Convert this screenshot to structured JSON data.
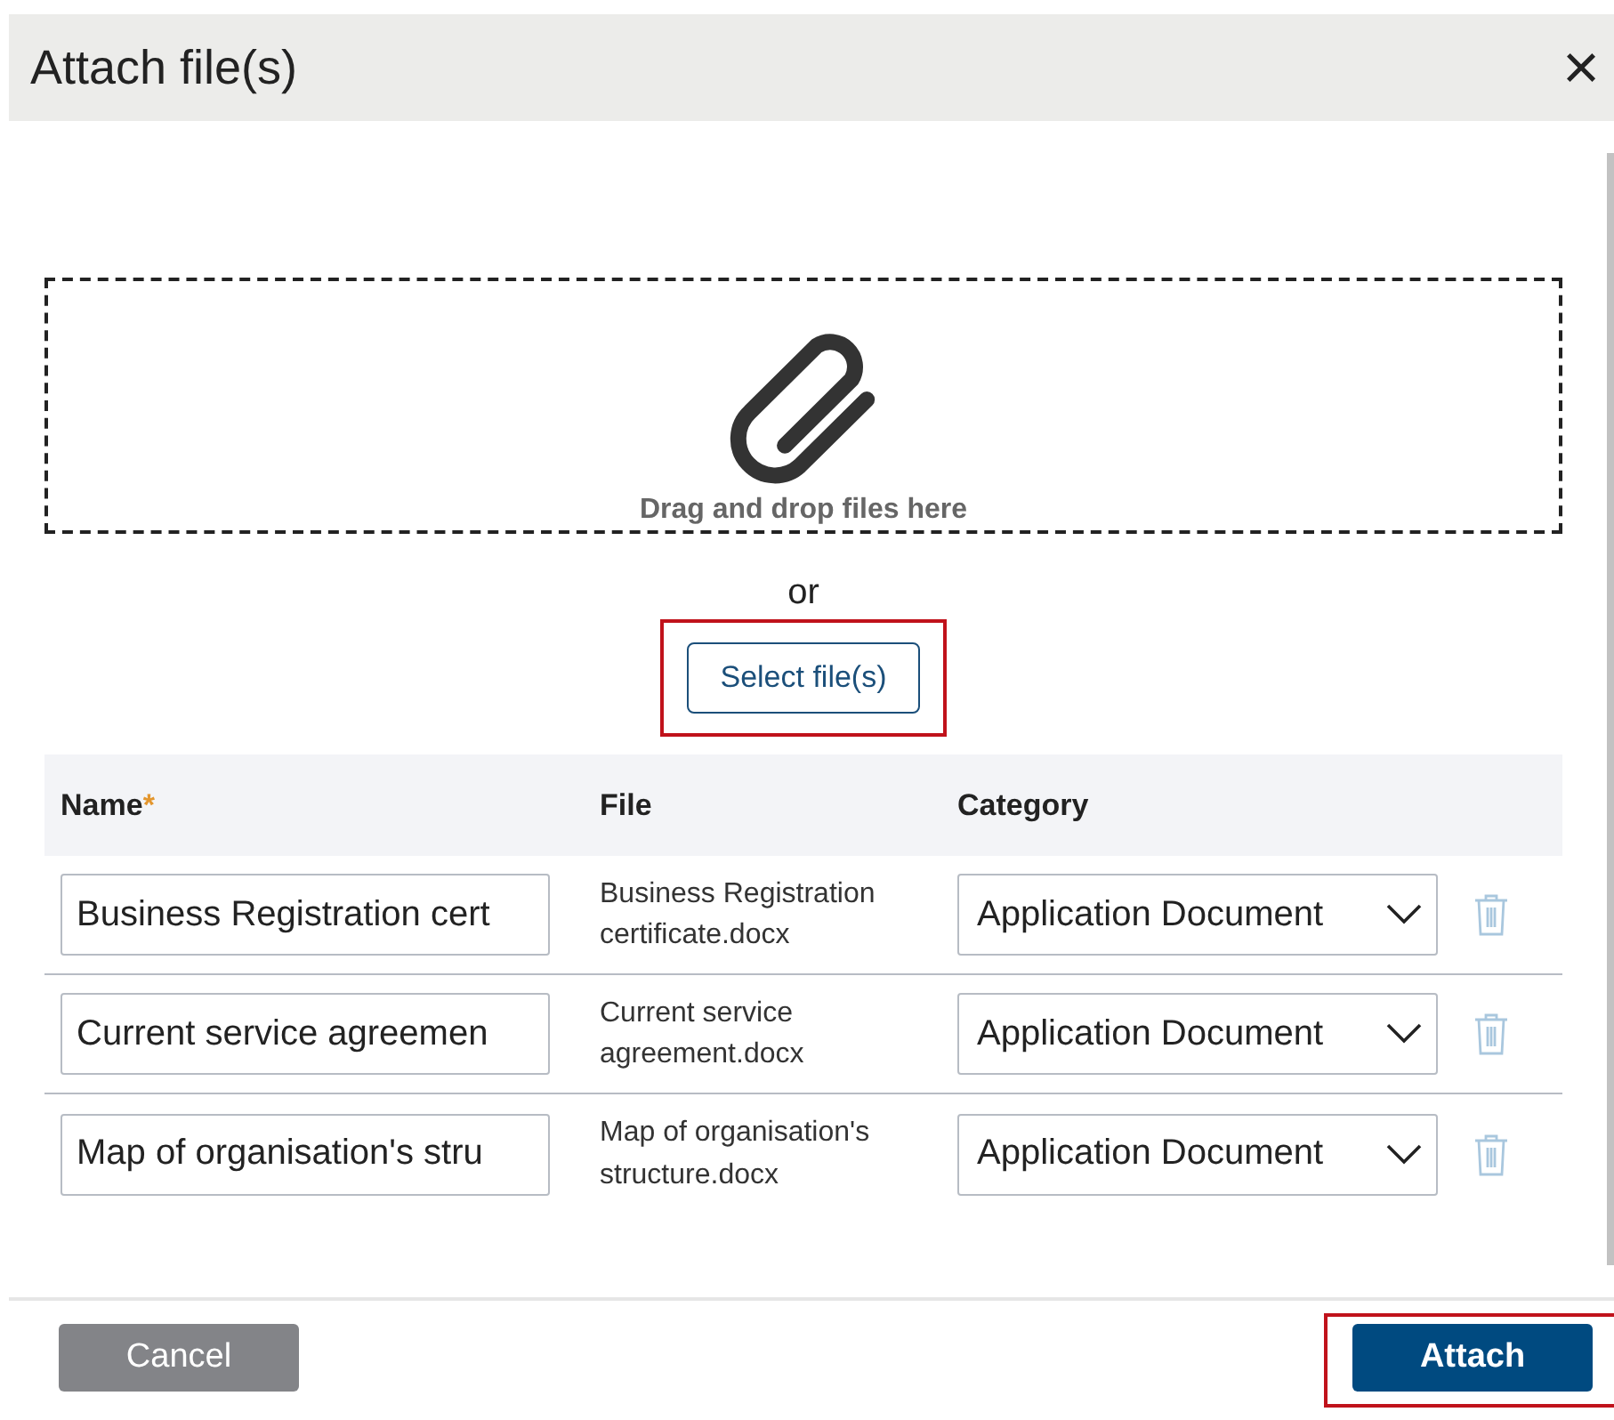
{
  "dialog": {
    "title": "Attach file(s)",
    "close": "×"
  },
  "dropzone": {
    "label": "Drag and drop files here"
  },
  "separator": "or",
  "select_button": {
    "label": "Select file(s)",
    "highlighted": true
  },
  "table": {
    "required_mark": "*",
    "columns": [
      {
        "label": "Name",
        "required": true
      },
      {
        "label": "File",
        "required": false
      },
      {
        "label": "Category",
        "required": false
      }
    ],
    "rows": [
      {
        "name": "Business Registration cert",
        "file": "Business Registration certificate.docx",
        "category": "Application Document"
      },
      {
        "name": "Current service agreemen",
        "file": "Current service agreement.docx",
        "category": "Application Document"
      },
      {
        "name": "Map of organisation's stru",
        "file": "Map of organisation's structure.docx",
        "category": "Application Document"
      }
    ]
  },
  "footer": {
    "cancel": {
      "label": "Cancel",
      "highlighted": false
    },
    "attach": {
      "label": "Attach",
      "highlighted": true
    }
  }
}
